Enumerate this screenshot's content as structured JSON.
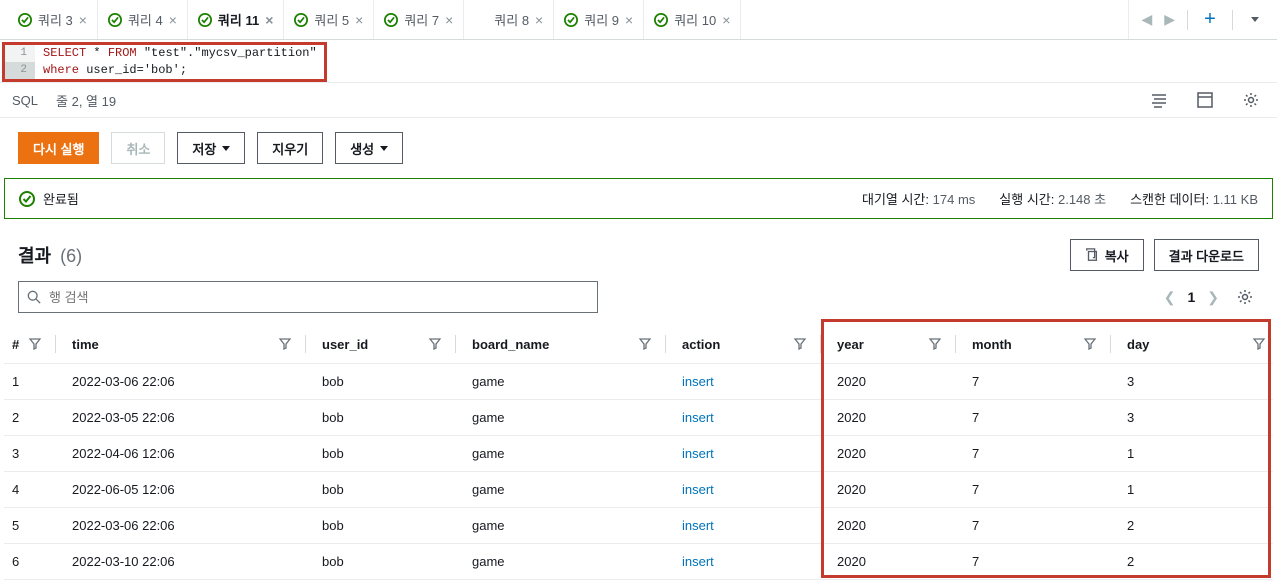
{
  "tabs": [
    {
      "label": "쿼리 3",
      "status": "ok",
      "active": false
    },
    {
      "label": "쿼리 4",
      "status": "ok",
      "active": false
    },
    {
      "label": "쿼리 11",
      "status": "ok",
      "active": true
    },
    {
      "label": "쿼리 5",
      "status": "ok",
      "active": false
    },
    {
      "label": "쿼리 7",
      "status": "ok",
      "active": false
    },
    {
      "label": "쿼리 8",
      "status": "none",
      "active": false
    },
    {
      "label": "쿼리 9",
      "status": "ok",
      "active": false
    },
    {
      "label": "쿼리 10",
      "status": "ok",
      "active": false
    }
  ],
  "editor": {
    "lines": [
      {
        "num": "1",
        "code_html": "<span class=\"kw\">SELECT</span> * <span class=\"kw\">FROM</span> \"test\".\"mycsv_partition\""
      },
      {
        "num": "2",
        "code_html": "<span class=\"kw\">where</span> user_id='bob';"
      }
    ]
  },
  "status_bar": {
    "lang": "SQL",
    "cursor": "줄 2, 열 19"
  },
  "actions": {
    "run": "다시 실행",
    "cancel": "취소",
    "save": "저장",
    "clear": "지우기",
    "create": "생성"
  },
  "completion": {
    "status": "완료됨",
    "stats": [
      {
        "label": "대기열 시간:",
        "val": "174 ms"
      },
      {
        "label": "실행 시간:",
        "val": "2.148 초"
      },
      {
        "label": "스캔한 데이터:",
        "val": "1.11 KB"
      }
    ]
  },
  "results": {
    "title": "결과",
    "count": "(6)",
    "copy_btn": "복사",
    "download_btn": "결과 다운로드",
    "search_placeholder": "행 검색",
    "page": "1",
    "columns": [
      "#",
      "time",
      "user_id",
      "board_name",
      "action",
      "year",
      "month",
      "day"
    ],
    "rows": [
      [
        "1",
        "2022-03-06 22:06",
        "bob",
        "game",
        "insert",
        "2020",
        "7",
        "3"
      ],
      [
        "2",
        "2022-03-05 22:06",
        "bob",
        "game",
        "insert",
        "2020",
        "7",
        "3"
      ],
      [
        "3",
        "2022-04-06 12:06",
        "bob",
        "game",
        "insert",
        "2020",
        "7",
        "1"
      ],
      [
        "4",
        "2022-06-05 12:06",
        "bob",
        "game",
        "insert",
        "2020",
        "7",
        "1"
      ],
      [
        "5",
        "2022-03-06 22:06",
        "bob",
        "game",
        "insert",
        "2020",
        "7",
        "2"
      ],
      [
        "6",
        "2022-03-10 22:06",
        "bob",
        "game",
        "insert",
        "2020",
        "7",
        "2"
      ]
    ]
  }
}
